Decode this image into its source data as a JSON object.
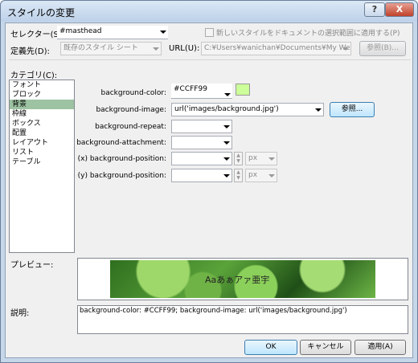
{
  "window": {
    "title": "スタイルの変更",
    "help_icon": "?",
    "close_icon": "X"
  },
  "selector": {
    "label": "セレクター(S):",
    "value": "#masthead"
  },
  "apply_checkbox": {
    "label": "新しいスタイルをドキュメントの選択範囲に適用する(P)",
    "checked": false
  },
  "define_in": {
    "label": "定義先(D):",
    "value": "既存のスタイル シート"
  },
  "url": {
    "label": "URL(U):",
    "value": "C:¥Users¥wanichan¥Documents¥My We",
    "browse_label": "参照(B)..."
  },
  "category": {
    "label": "カテゴリ(C):",
    "items": [
      "フォント",
      "ブロック",
      "背景",
      "枠線",
      "ボックス",
      "配置",
      "レイアウト",
      "リスト",
      "テーブル"
    ],
    "selected_index": 2
  },
  "props": {
    "bg_color": {
      "label": "background-color:",
      "value": "#CCFF99",
      "swatch": "#CCFF99"
    },
    "bg_image": {
      "label": "background-image:",
      "value": "url('images/background.jpg')",
      "browse_label": "参照..."
    },
    "bg_repeat": {
      "label": "background-repeat:",
      "value": ""
    },
    "bg_attachment": {
      "label": "background-attachment:",
      "value": ""
    },
    "bg_pos_x": {
      "label": "(x) background-position:",
      "value": "",
      "unit": "px"
    },
    "bg_pos_y": {
      "label": "(y) background-position:",
      "value": "",
      "unit": "px"
    }
  },
  "preview": {
    "label": "プレビュー:",
    "sample_text": "Aaあぁアァ亜宇"
  },
  "description": {
    "label": "説明:",
    "text": "background-color: #CCFF99; background-image: url('images/background.jpg')"
  },
  "buttons": {
    "ok": "OK",
    "cancel": "キャンセル",
    "apply": "適用(A)"
  }
}
